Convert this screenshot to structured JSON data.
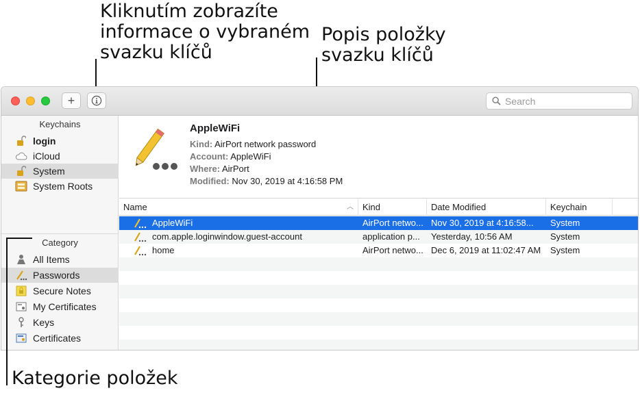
{
  "callouts": {
    "info": [
      "Kliknutím zobrazíte",
      "informace o vybraném",
      "svazku klíčů"
    ],
    "description": [
      "Popis položky",
      "svazku klíčů"
    ],
    "categories": [
      "Kategorie položek"
    ]
  },
  "toolbar": {
    "add_label": "+",
    "info_label": "ⓘ",
    "search_placeholder": "Search"
  },
  "sidebar": {
    "keychains_title": "Keychains",
    "keychains": [
      {
        "label": "login",
        "icon": "unlocked-padlock-icon"
      },
      {
        "label": "iCloud",
        "icon": "cloud-icon"
      },
      {
        "label": "System",
        "icon": "unlocked-padlock-icon"
      },
      {
        "label": "System Roots",
        "icon": "cabinet-icon"
      }
    ],
    "category_title": "Category",
    "categories": [
      {
        "label": "All Items",
        "icon": "people-icon"
      },
      {
        "label": "Passwords",
        "icon": "password-icon"
      },
      {
        "label": "Secure Notes",
        "icon": "secure-note-icon"
      },
      {
        "label": "My Certificates",
        "icon": "my-certificate-icon"
      },
      {
        "label": "Keys",
        "icon": "key-icon"
      },
      {
        "label": "Certificates",
        "icon": "certificate-icon"
      }
    ]
  },
  "detail": {
    "title": "AppleWiFi",
    "kind_label": "Kind:",
    "kind_value": "AirPort network password",
    "account_label": "Account:",
    "account_value": "AppleWiFi",
    "where_label": "Where:",
    "where_value": "AirPort",
    "modified_label": "Modified:",
    "modified_value": "Nov 30, 2019 at 4:16:58 PM"
  },
  "table": {
    "columns": [
      "Name",
      "Kind",
      "Date Modified",
      "Keychain"
    ],
    "rows": [
      {
        "name": "AppleWiFi",
        "kind": "AirPort netwo...",
        "date": "Nov 30, 2019 at 4:16:58...",
        "keychain": "System"
      },
      {
        "name": "com.apple.loginwindow.guest-account",
        "kind": "application p...",
        "date": "Yesterday, 10:56 AM",
        "keychain": "System"
      },
      {
        "name": "home",
        "kind": "AirPort netwo...",
        "date": "Dec 6, 2019 at 11:02:47 AM",
        "keychain": "System"
      }
    ]
  },
  "colors": {
    "selection": "#1a6ee6",
    "sidebar_bg": "#f6f6f6"
  }
}
